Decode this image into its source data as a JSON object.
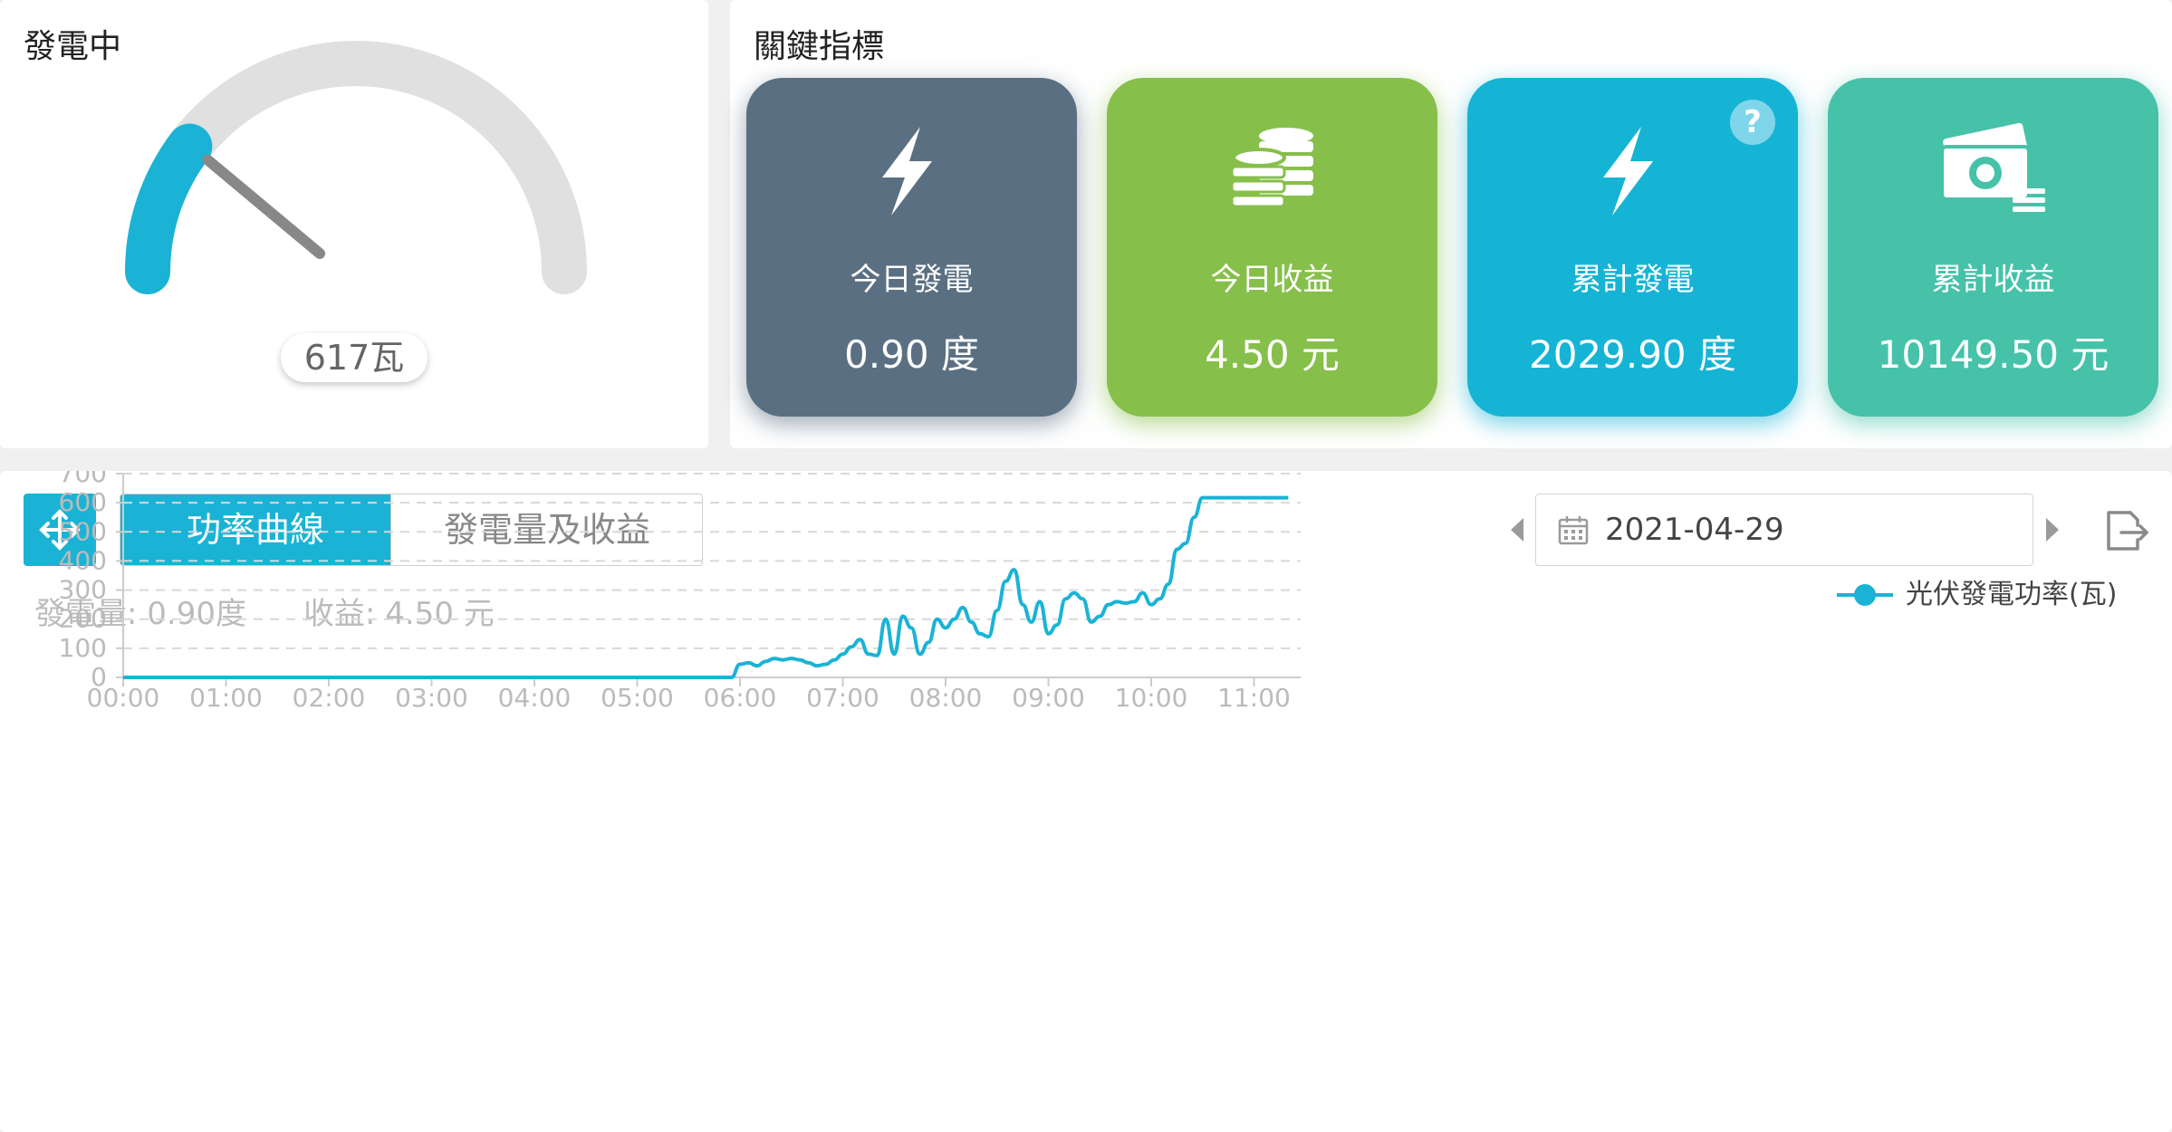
{
  "gauge": {
    "title": "發電中",
    "value": 617,
    "max": 3000,
    "label": "617瓦",
    "colors": {
      "track": "#e0e0e0",
      "fill": "#1ab3d5",
      "needle": "#888888"
    }
  },
  "kpi": {
    "title": "關鍵指標",
    "cards": [
      {
        "label": "今日發電",
        "value": "0.90 度",
        "icon": "lightning-icon",
        "color": "#5a6f82"
      },
      {
        "label": "今日收益",
        "value": "4.50 元",
        "icon": "coins-icon",
        "color": "#86bf4a"
      },
      {
        "label": "累計發電",
        "value": "2029.90 度",
        "icon": "lightning-icon",
        "color": "#15b4d5",
        "help": "?"
      },
      {
        "label": "累計收益",
        "value": "10149.50 元",
        "icon": "money-icon",
        "color": "#46c2a9"
      }
    ]
  },
  "chart_panel": {
    "tabs": [
      "功率曲線",
      "發電量及收益"
    ],
    "active_tab": 0,
    "date": "2021-04-29",
    "summary": {
      "energy": "發電量: 0.90度",
      "income": "收益: 4.50 元"
    }
  },
  "chart_data": {
    "type": "line",
    "ylabel": "瓦",
    "ylim": [
      0,
      700
    ],
    "yticks": [
      "700",
      "600",
      "500",
      "400",
      "300",
      "200",
      "100",
      "0"
    ],
    "xticks": [
      "00:00",
      "01:00",
      "02:00",
      "03:00",
      "04:00",
      "05:00",
      "06:00",
      "07:00",
      "08:00",
      "09:00",
      "10:00",
      "11:00"
    ],
    "grid": true,
    "legend": "top-right",
    "color": "#1ab3d5",
    "series": [
      {
        "name": "光伏發電功率(瓦)",
        "x": [
          "00:00",
          "05:55",
          "06:00",
          "06:05",
          "06:10",
          "06:15",
          "06:20",
          "06:25",
          "06:30",
          "06:35",
          "06:40",
          "06:45",
          "06:50",
          "06:55",
          "07:00",
          "07:05",
          "07:10",
          "07:15",
          "07:20",
          "07:25",
          "07:30",
          "07:35",
          "07:40",
          "07:45",
          "07:50",
          "07:55",
          "08:00",
          "08:05",
          "08:10",
          "08:15",
          "08:20",
          "08:25",
          "08:30",
          "08:35",
          "08:40",
          "08:45",
          "08:50",
          "08:55",
          "09:00",
          "09:05",
          "09:10",
          "09:15",
          "09:20",
          "09:25",
          "09:30",
          "09:35",
          "09:40",
          "09:45",
          "09:50",
          "09:55",
          "10:00",
          "10:05",
          "10:10",
          "10:15",
          "10:20",
          "10:25",
          "10:30",
          "10:35",
          "10:40",
          "10:45",
          "10:50",
          "10:55",
          "11:00",
          "11:05",
          "11:10",
          "11:15",
          "11:20",
          "11:25",
          "11:30",
          "11:35"
        ],
        "y": [
          0,
          0,
          45,
          50,
          40,
          55,
          65,
          60,
          65,
          60,
          50,
          40,
          45,
          60,
          80,
          105,
          130,
          80,
          75,
          200,
          80,
          210,
          170,
          80,
          120,
          200,
          170,
          200,
          240,
          190,
          150,
          140,
          230,
          330,
          370,
          250,
          190,
          260,
          150,
          180,
          270,
          290,
          270,
          190,
          210,
          250,
          260,
          255,
          260,
          290,
          250,
          270,
          320,
          440,
          460,
          550,
          617,
          617,
          617,
          617,
          617,
          617,
          617,
          617,
          617,
          617,
          617,
          617,
          617,
          617
        ]
      }
    ]
  }
}
